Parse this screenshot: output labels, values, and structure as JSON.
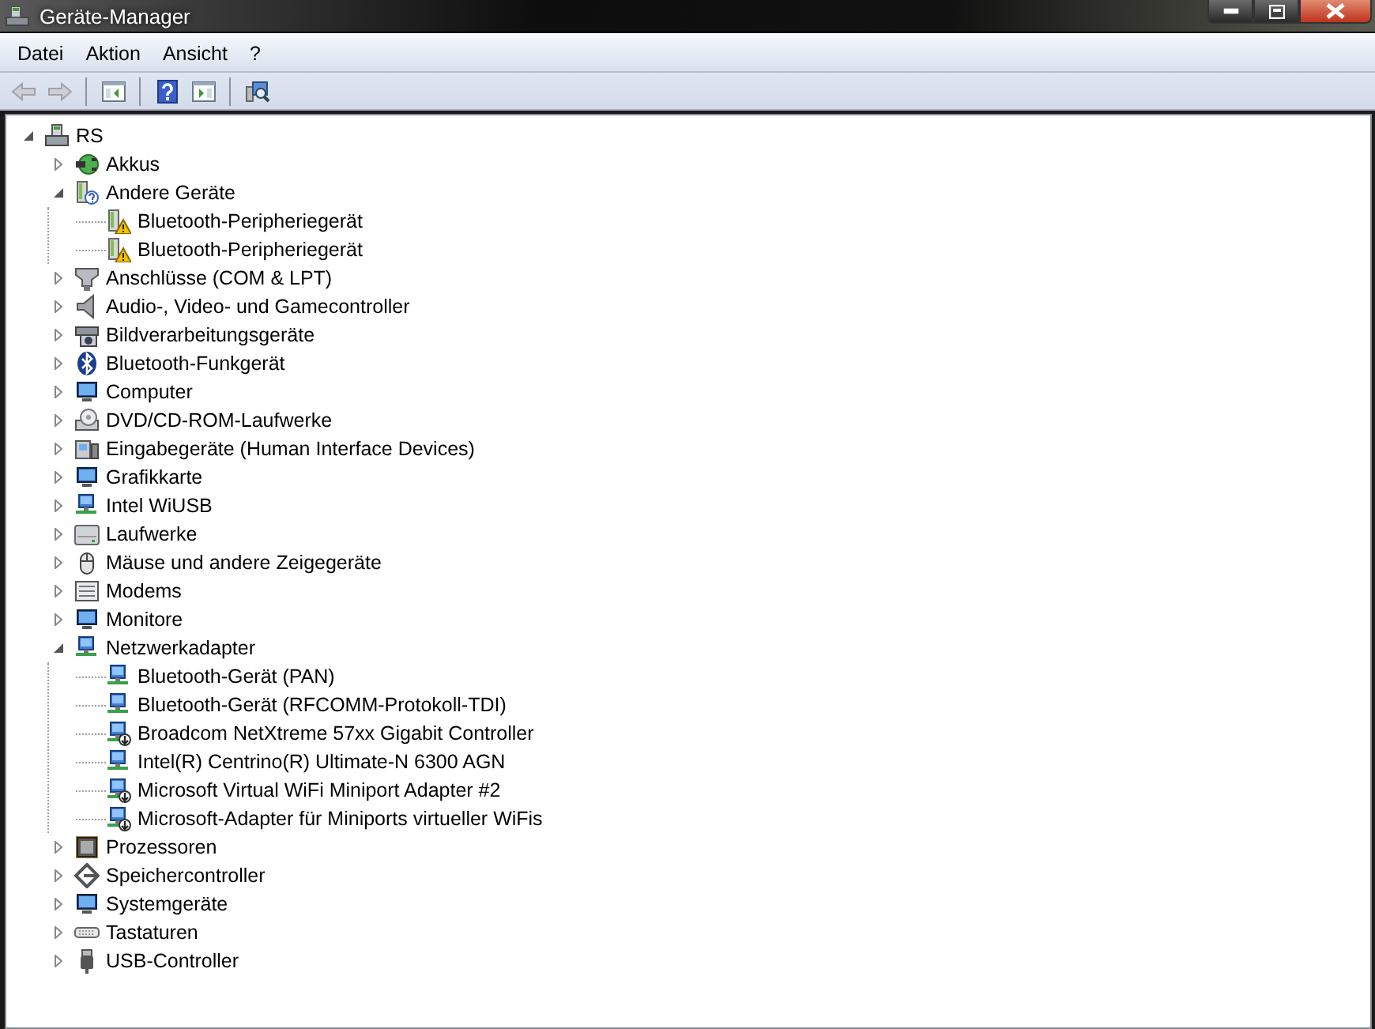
{
  "window": {
    "title": "Geräte-Manager"
  },
  "menu": [
    "Datei",
    "Aktion",
    "Ansicht",
    "?"
  ],
  "toolbar": [
    {
      "kind": "back",
      "disabled": true
    },
    {
      "kind": "forward",
      "disabled": true
    },
    {
      "kind": "separator"
    },
    {
      "kind": "tree-pane",
      "disabled": false
    },
    {
      "kind": "separator"
    },
    {
      "kind": "help",
      "disabled": false
    },
    {
      "kind": "action-pane",
      "disabled": false
    },
    {
      "kind": "separator"
    },
    {
      "kind": "scan",
      "disabled": false
    }
  ],
  "tree": [
    {
      "label": "RS",
      "kind": "computer",
      "expanded": true,
      "children": [
        {
          "label": "Akkus",
          "kind": "battery",
          "expanded": false
        },
        {
          "label": "Andere Geräte",
          "kind": "unknown",
          "expanded": true,
          "children": [
            {
              "label": "Bluetooth-Peripheriegerät",
              "kind": "warning"
            },
            {
              "label": "Bluetooth-Peripheriegerät",
              "kind": "warning"
            }
          ]
        },
        {
          "label": "Anschlüsse (COM & LPT)",
          "kind": "port",
          "expanded": false
        },
        {
          "label": "Audio-, Video- und Gamecontroller",
          "kind": "speaker",
          "expanded": false
        },
        {
          "label": "Bildverarbeitungsgeräte",
          "kind": "camera",
          "expanded": false
        },
        {
          "label": "Bluetooth-Funkgerät",
          "kind": "bluetooth",
          "expanded": false
        },
        {
          "label": "Computer",
          "kind": "monitor",
          "expanded": false
        },
        {
          "label": "DVD/CD-ROM-Laufwerke",
          "kind": "disc",
          "expanded": false
        },
        {
          "label": "Eingabegeräte (Human Interface Devices)",
          "kind": "hid",
          "expanded": false
        },
        {
          "label": "Grafikkarte",
          "kind": "monitor",
          "expanded": false
        },
        {
          "label": "Intel WiUSB",
          "kind": "network",
          "expanded": false
        },
        {
          "label": "Laufwerke",
          "kind": "drive",
          "expanded": false
        },
        {
          "label": "Mäuse und andere Zeigegeräte",
          "kind": "mouse",
          "expanded": false
        },
        {
          "label": "Modems",
          "kind": "modem",
          "expanded": false
        },
        {
          "label": "Monitore",
          "kind": "monitor",
          "expanded": false
        },
        {
          "label": "Netzwerkadapter",
          "kind": "network",
          "expanded": true,
          "children": [
            {
              "label": "Bluetooth-Gerät (PAN)",
              "kind": "network"
            },
            {
              "label": "Bluetooth-Gerät (RFCOMM-Protokoll-TDI)",
              "kind": "network"
            },
            {
              "label": "Broadcom NetXtreme 57xx Gigabit Controller",
              "kind": "network-disabled"
            },
            {
              "label": "Intel(R) Centrino(R) Ultimate-N 6300 AGN",
              "kind": "network"
            },
            {
              "label": "Microsoft Virtual WiFi Miniport Adapter #2",
              "kind": "network-disabled"
            },
            {
              "label": "Microsoft-Adapter für Miniports virtueller WiFis",
              "kind": "network-disabled"
            }
          ]
        },
        {
          "label": "Prozessoren",
          "kind": "chip",
          "expanded": false
        },
        {
          "label": "Speichercontroller",
          "kind": "storage",
          "expanded": false
        },
        {
          "label": "Systemgeräte",
          "kind": "monitor",
          "expanded": false
        },
        {
          "label": "Tastaturen",
          "kind": "keyboard",
          "expanded": false
        },
        {
          "label": "USB-Controller",
          "kind": "usb",
          "expanded": false
        }
      ]
    }
  ]
}
